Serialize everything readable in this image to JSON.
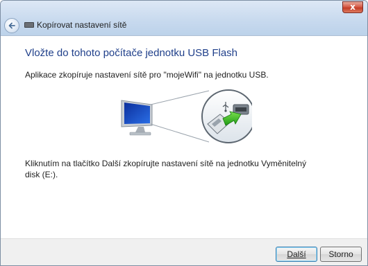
{
  "window": {
    "title": "Kopírovat nastavení sítě",
    "close_glyph": "x"
  },
  "content": {
    "heading": "Vložte do tohoto počítače jednotku USB Flash",
    "description": "Aplikace zkopíruje nastavení sítě pro \"mojeWifi\" na jednotku USB.",
    "instructions": "Kliknutím na tlačítko Další zkopírujte nastavení sítě na jednotku Vyměnitelný disk (E:)."
  },
  "buttons": {
    "next": "Další",
    "cancel": "Storno"
  },
  "icons": {
    "back": "back-arrow-icon",
    "title": "network-icon",
    "computer": "computer-icon",
    "usb": "usb-flash-drive-icon"
  },
  "colors": {
    "heading": "#1f3f8a",
    "arrow": "#3db51f",
    "close": "#c23b26"
  }
}
